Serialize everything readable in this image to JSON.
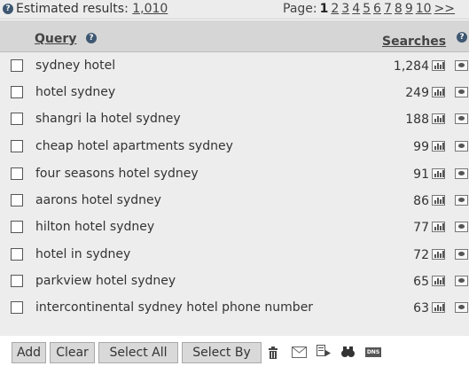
{
  "results": {
    "estimated_label": "Estimated results:",
    "estimated_count": "1,010",
    "page_label": "Page:",
    "pages": [
      "1",
      "2",
      "3",
      "4",
      "5",
      "6",
      "7",
      "8",
      "9",
      "10"
    ],
    "current_page": "1",
    "next_label": ">>"
  },
  "table": {
    "col_query": "Query",
    "col_searches": "Searches",
    "rows": [
      {
        "query": "sydney hotel",
        "searches": "1,284"
      },
      {
        "query": "hotel sydney",
        "searches": "249"
      },
      {
        "query": "shangri la hotel sydney",
        "searches": "188"
      },
      {
        "query": "cheap hotel apartments sydney",
        "searches": "99"
      },
      {
        "query": "four seasons hotel sydney",
        "searches": "91"
      },
      {
        "query": "aarons hotel sydney",
        "searches": "86"
      },
      {
        "query": "hilton hotel sydney",
        "searches": "77"
      },
      {
        "query": "hotel in sydney",
        "searches": "72"
      },
      {
        "query": "parkview hotel sydney",
        "searches": "65"
      },
      {
        "query": "intercontinental sydney hotel phone number",
        "searches": "63"
      }
    ]
  },
  "toolbar": {
    "add_label": "Add",
    "clear_label": "Clear",
    "select_all_label": "Select All",
    "select_by_label": "Select By",
    "icons": [
      "trash-icon",
      "envelope-icon",
      "export-icon",
      "binoculars-icon",
      "dns-icon"
    ],
    "dns_text": "DNS"
  }
}
